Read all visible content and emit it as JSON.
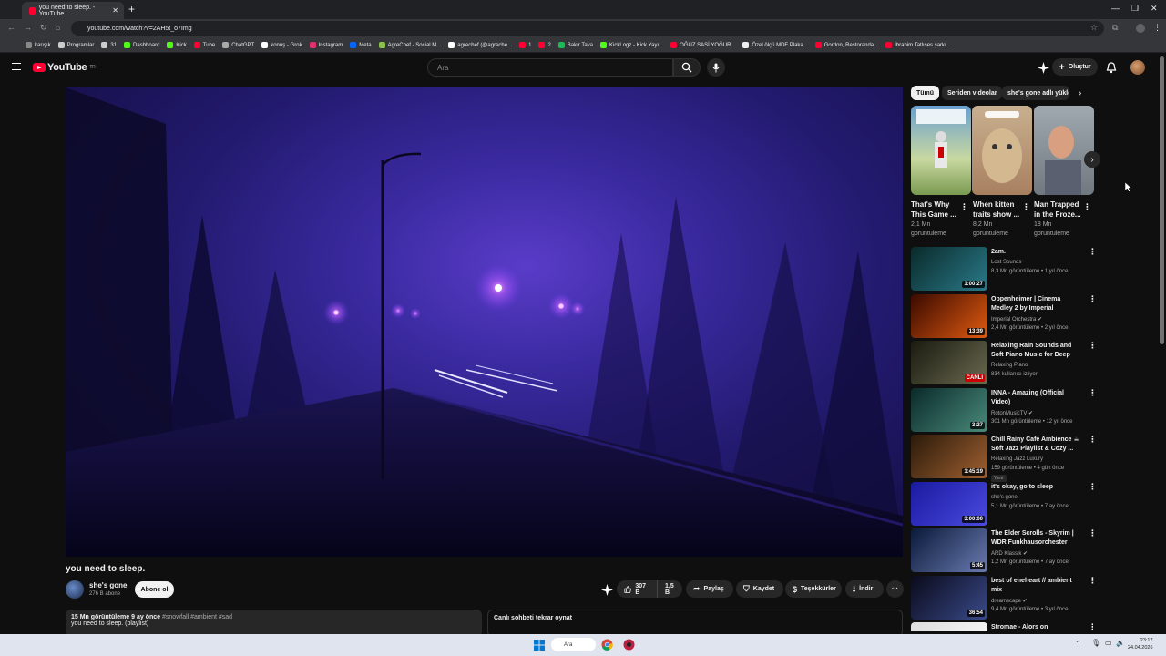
{
  "browser": {
    "tab_title": "you need to sleep. - YouTube",
    "tab_close": "✕",
    "new_tab": "+",
    "url": "youtube.com/watch?v=2AH5t_o7Img",
    "bookmarks": [
      "karışık",
      "Programlar",
      "31",
      "Dashboard",
      "Kick",
      "Tube",
      "ChatGPT",
      "konuş - Grok",
      "Instagram",
      "Meta",
      "AgreChef - Social M...",
      "agrechef (@agreche...",
      "1",
      "2",
      "Bakır Tava",
      "KickLogz - Kick Yayı...",
      "OĞUZ SASİ YOĞUR...",
      "Özel ölçü MDF Plaka...",
      "Gordon, Restoranda...",
      "İbrahim Tatlıses şarkı..."
    ]
  },
  "header": {
    "logo_text": "YouTube",
    "logo_region": "TR",
    "search_placeholder": "Ara",
    "create_label": "Oluştur"
  },
  "video": {
    "title": "you need to sleep.",
    "channel": "she's gone",
    "subscribers": "276 B abone",
    "subscribe_label": "Abone ol",
    "likes": "307 B",
    "views_short": "1,5 B",
    "share_label": "Paylaş",
    "save_label": "Kaydet",
    "thanks_label": "Teşekkürler",
    "download_label": "İndir",
    "more_label": "···"
  },
  "description": {
    "views": "15 Mn görüntüleme",
    "age": "9 ay önce",
    "tags": "#snowfall #ambient #sad",
    "text": "you need to sleep. (playlist)"
  },
  "chat": {
    "title": "Canlı sohbeti tekrar oynat"
  },
  "chips": [
    "Tümü",
    "Seriden videolar",
    "she's gone adlı yükleyiciden"
  ],
  "shorts": [
    {
      "title": "That's Why This Game ...",
      "views": "2,1 Mn",
      "views_unit": "görüntüleme"
    },
    {
      "title": "When kitten traits show ...",
      "views": "8,2 Mn",
      "views_unit": "görüntüleme"
    },
    {
      "title": "Man Trapped in the Froze...",
      "views": "18 Mn",
      "views_unit": "görüntüleme"
    }
  ],
  "recommendations": [
    {
      "title": "2am.",
      "channel": "Lost Sounds",
      "meta": "8,3 Mn görüntüleme • 1 yıl önce",
      "duration": "1:00:27",
      "colors": [
        "#0a2a2a",
        "#2a7a8a"
      ]
    },
    {
      "title": "Oppenheimer | Cinema Medley 2 by Imperial Orchestra",
      "channel": "Imperial Orchestra ✔",
      "meta": "2,4 Mn görüntüleme • 2 yıl önce",
      "duration": "13:39",
      "colors": [
        "#3a0a00",
        "#e05a10"
      ]
    },
    {
      "title": "Relaxing Rain Sounds and Soft Piano Music for Deep Sleep, ...",
      "channel": "Relaxing Piano",
      "meta": "834 kullanıcı izliyor",
      "duration": "CANLI",
      "colors": [
        "#1a1a10",
        "#6a6a50"
      ]
    },
    {
      "title": "INNA - Amazing (Official Video)",
      "channel": "RotonMusicTV ✔",
      "meta": "301 Mn görüntüleme • 12 yıl önce",
      "duration": "3:27",
      "colors": [
        "#0a2a2a",
        "#4a8a7a"
      ]
    },
    {
      "title": "Chill Rainy Café Ambience ☕ Soft Jazz Playlist & Cozy ...",
      "channel": "Relaxing Jazz Luxury",
      "meta": "159 görüntüleme • 4 gün önce",
      "badge": "Yeni",
      "duration": "1:45:19",
      "colors": [
        "#2a1a0a",
        "#a06030"
      ]
    },
    {
      "title": "it's okay, go to sleep",
      "channel": "she's gone",
      "meta": "5,1 Mn görüntüleme • 7 ay önce",
      "duration": "3:00:00",
      "colors": [
        "#1a1aa0",
        "#4a4ae0"
      ]
    },
    {
      "title": "The Elder Scrolls - Skyrim | WDR Funkhausorchester",
      "channel": "ARD Klassik ✔",
      "meta": "1,2 Mn görüntüleme • 7 ay önce",
      "duration": "5:45",
      "colors": [
        "#0a1a3a",
        "#6a7ab0"
      ]
    },
    {
      "title": "best of eneheart // ambient mix",
      "channel": "dreamscape ✔",
      "meta": "9,4 Mn görüntüleme • 3 yıl önce",
      "duration": "36:54",
      "colors": [
        "#0a0a1a",
        "#3a4a8a"
      ]
    },
    {
      "title": "Stromae - Alors on",
      "channel": "",
      "meta": "",
      "duration": "",
      "colors": [
        "#ddd",
        "#fff"
      ]
    }
  ],
  "taskbar": {
    "search": "Ara",
    "time": "23:17",
    "date": "24.04.2026"
  }
}
